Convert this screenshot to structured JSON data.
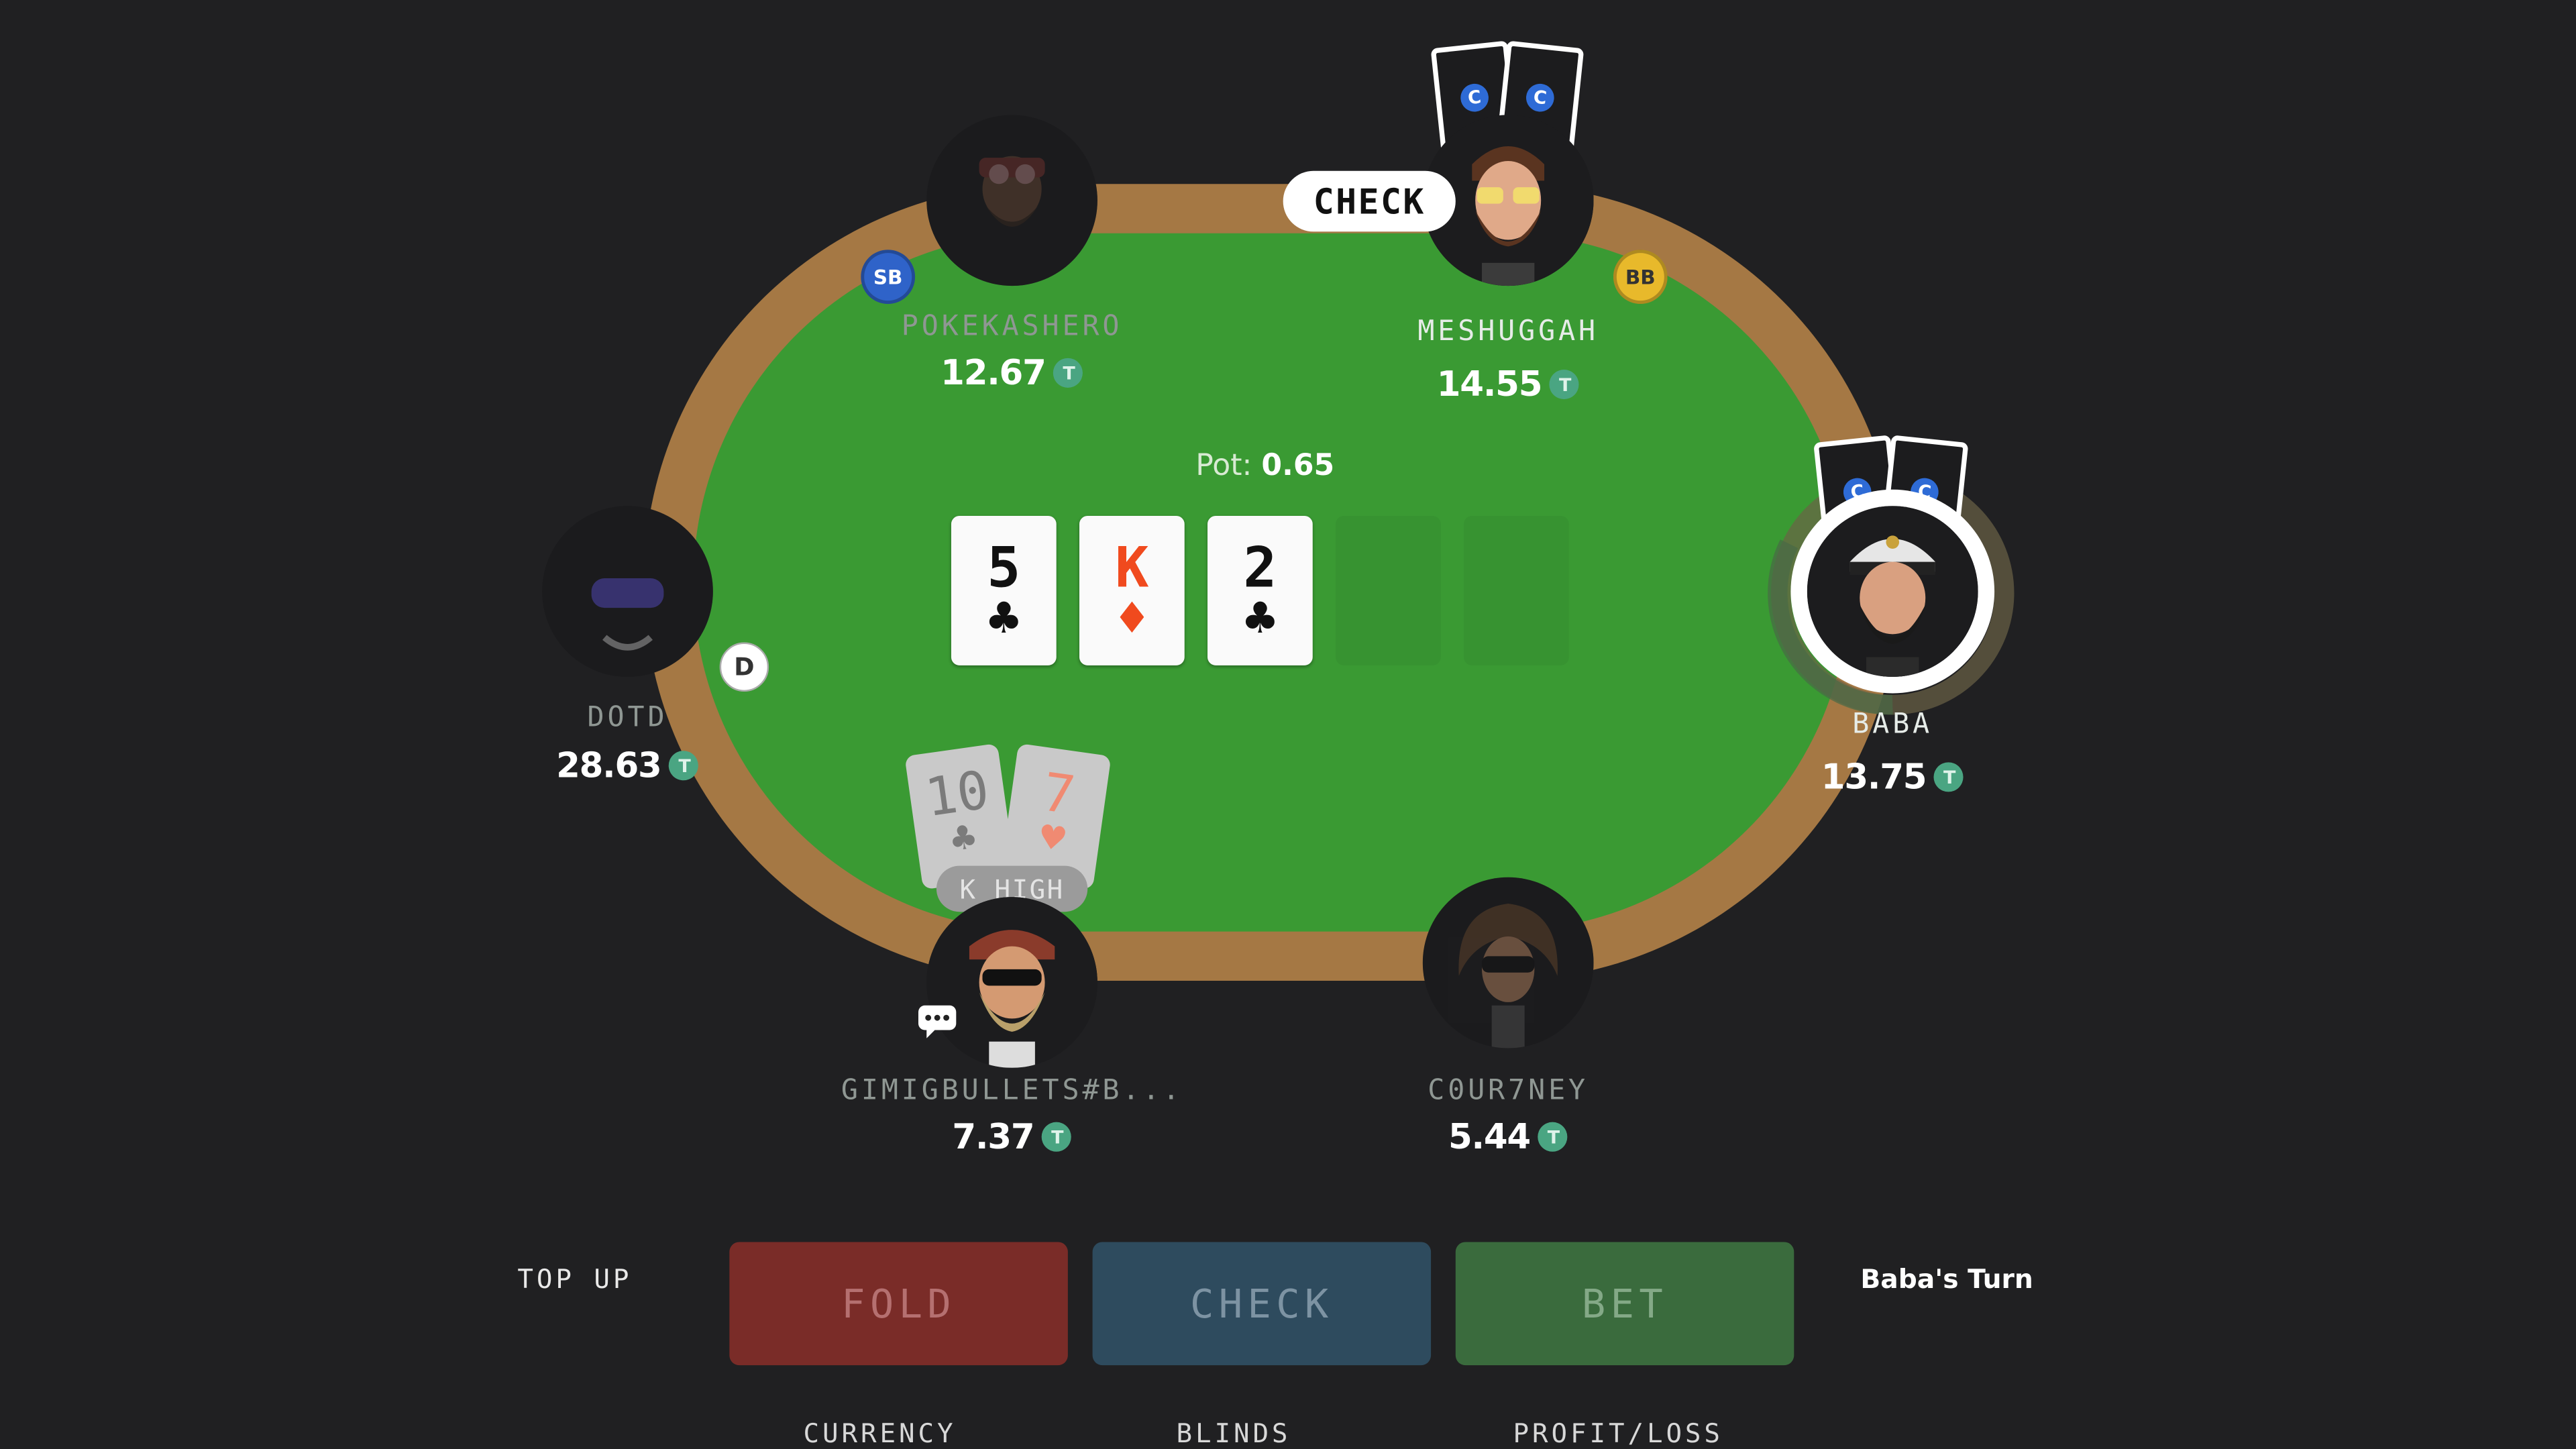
{
  "table": {
    "pot_label": "Pot:",
    "pot_value": "0.65",
    "board": [
      {
        "rank": "5",
        "suit": "♣",
        "color": "#111111"
      },
      {
        "rank": "K",
        "suit": "♦",
        "color": "#f04a1e"
      },
      {
        "rank": "2",
        "suit": "♣",
        "color": "#111111"
      }
    ],
    "empty_slots": 2,
    "colors": {
      "felt": "#3a9a33",
      "rail": "#a57844",
      "background": "#202022"
    }
  },
  "players": {
    "pokekashero": {
      "name": "POKEKASHERO",
      "stack": "12.67",
      "badge": "SB"
    },
    "meshuggah": {
      "name": "MESHUGGAH",
      "stack": "14.55",
      "badge": "BB",
      "action": "CHECK"
    },
    "baba": {
      "name": "BABA",
      "stack": "13.75"
    },
    "dotd": {
      "name": "DOTD",
      "stack": "28.63",
      "dealer": "D"
    },
    "hero": {
      "name": "GIMIGBULLETS#B...",
      "stack": "7.37",
      "hand_label": "K HIGH",
      "cards": [
        {
          "rank": "10",
          "suit": "♣",
          "color": "#7b7b7b"
        },
        {
          "rank": "7",
          "suit": "♥",
          "color": "#f08a72"
        }
      ]
    },
    "courtney": {
      "name": "C0UR7NEY",
      "stack": "5.44"
    }
  },
  "token_symbol": "T",
  "card_back_logo": "C",
  "actions": {
    "fold": "FOLD",
    "check": "CHECK",
    "bet": "BET"
  },
  "topup": "TOP UP",
  "turn_text": "Baba's Turn",
  "footer": {
    "currency": "CURRENCY",
    "blinds": "BLINDS",
    "profit_loss": "PROFIT/LOSS"
  },
  "icons": [
    "token-icon",
    "card-back-logo-icon",
    "chat-icon",
    "turn-timer-ring"
  ]
}
